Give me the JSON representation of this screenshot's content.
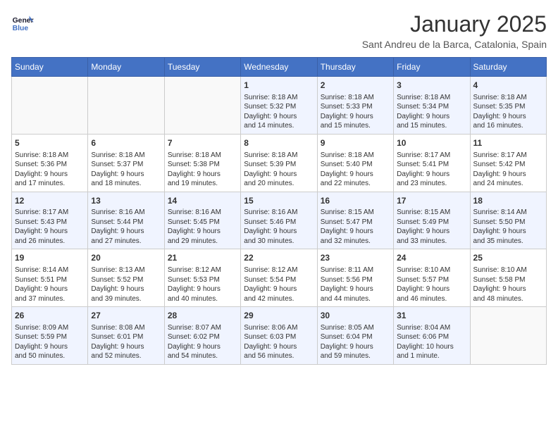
{
  "header": {
    "logo_line1": "General",
    "logo_line2": "Blue",
    "month_title": "January 2025",
    "subtitle": "Sant Andreu de la Barca, Catalonia, Spain"
  },
  "weekdays": [
    "Sunday",
    "Monday",
    "Tuesday",
    "Wednesday",
    "Thursday",
    "Friday",
    "Saturday"
  ],
  "weeks": [
    [
      {
        "day": "",
        "info": ""
      },
      {
        "day": "",
        "info": ""
      },
      {
        "day": "",
        "info": ""
      },
      {
        "day": "1",
        "info": "Sunrise: 8:18 AM\nSunset: 5:32 PM\nDaylight: 9 hours\nand 14 minutes."
      },
      {
        "day": "2",
        "info": "Sunrise: 8:18 AM\nSunset: 5:33 PM\nDaylight: 9 hours\nand 15 minutes."
      },
      {
        "day": "3",
        "info": "Sunrise: 8:18 AM\nSunset: 5:34 PM\nDaylight: 9 hours\nand 15 minutes."
      },
      {
        "day": "4",
        "info": "Sunrise: 8:18 AM\nSunset: 5:35 PM\nDaylight: 9 hours\nand 16 minutes."
      }
    ],
    [
      {
        "day": "5",
        "info": "Sunrise: 8:18 AM\nSunset: 5:36 PM\nDaylight: 9 hours\nand 17 minutes."
      },
      {
        "day": "6",
        "info": "Sunrise: 8:18 AM\nSunset: 5:37 PM\nDaylight: 9 hours\nand 18 minutes."
      },
      {
        "day": "7",
        "info": "Sunrise: 8:18 AM\nSunset: 5:38 PM\nDaylight: 9 hours\nand 19 minutes."
      },
      {
        "day": "8",
        "info": "Sunrise: 8:18 AM\nSunset: 5:39 PM\nDaylight: 9 hours\nand 20 minutes."
      },
      {
        "day": "9",
        "info": "Sunrise: 8:18 AM\nSunset: 5:40 PM\nDaylight: 9 hours\nand 22 minutes."
      },
      {
        "day": "10",
        "info": "Sunrise: 8:17 AM\nSunset: 5:41 PM\nDaylight: 9 hours\nand 23 minutes."
      },
      {
        "day": "11",
        "info": "Sunrise: 8:17 AM\nSunset: 5:42 PM\nDaylight: 9 hours\nand 24 minutes."
      }
    ],
    [
      {
        "day": "12",
        "info": "Sunrise: 8:17 AM\nSunset: 5:43 PM\nDaylight: 9 hours\nand 26 minutes."
      },
      {
        "day": "13",
        "info": "Sunrise: 8:16 AM\nSunset: 5:44 PM\nDaylight: 9 hours\nand 27 minutes."
      },
      {
        "day": "14",
        "info": "Sunrise: 8:16 AM\nSunset: 5:45 PM\nDaylight: 9 hours\nand 29 minutes."
      },
      {
        "day": "15",
        "info": "Sunrise: 8:16 AM\nSunset: 5:46 PM\nDaylight: 9 hours\nand 30 minutes."
      },
      {
        "day": "16",
        "info": "Sunrise: 8:15 AM\nSunset: 5:47 PM\nDaylight: 9 hours\nand 32 minutes."
      },
      {
        "day": "17",
        "info": "Sunrise: 8:15 AM\nSunset: 5:49 PM\nDaylight: 9 hours\nand 33 minutes."
      },
      {
        "day": "18",
        "info": "Sunrise: 8:14 AM\nSunset: 5:50 PM\nDaylight: 9 hours\nand 35 minutes."
      }
    ],
    [
      {
        "day": "19",
        "info": "Sunrise: 8:14 AM\nSunset: 5:51 PM\nDaylight: 9 hours\nand 37 minutes."
      },
      {
        "day": "20",
        "info": "Sunrise: 8:13 AM\nSunset: 5:52 PM\nDaylight: 9 hours\nand 39 minutes."
      },
      {
        "day": "21",
        "info": "Sunrise: 8:12 AM\nSunset: 5:53 PM\nDaylight: 9 hours\nand 40 minutes."
      },
      {
        "day": "22",
        "info": "Sunrise: 8:12 AM\nSunset: 5:54 PM\nDaylight: 9 hours\nand 42 minutes."
      },
      {
        "day": "23",
        "info": "Sunrise: 8:11 AM\nSunset: 5:56 PM\nDaylight: 9 hours\nand 44 minutes."
      },
      {
        "day": "24",
        "info": "Sunrise: 8:10 AM\nSunset: 5:57 PM\nDaylight: 9 hours\nand 46 minutes."
      },
      {
        "day": "25",
        "info": "Sunrise: 8:10 AM\nSunset: 5:58 PM\nDaylight: 9 hours\nand 48 minutes."
      }
    ],
    [
      {
        "day": "26",
        "info": "Sunrise: 8:09 AM\nSunset: 5:59 PM\nDaylight: 9 hours\nand 50 minutes."
      },
      {
        "day": "27",
        "info": "Sunrise: 8:08 AM\nSunset: 6:01 PM\nDaylight: 9 hours\nand 52 minutes."
      },
      {
        "day": "28",
        "info": "Sunrise: 8:07 AM\nSunset: 6:02 PM\nDaylight: 9 hours\nand 54 minutes."
      },
      {
        "day": "29",
        "info": "Sunrise: 8:06 AM\nSunset: 6:03 PM\nDaylight: 9 hours\nand 56 minutes."
      },
      {
        "day": "30",
        "info": "Sunrise: 8:05 AM\nSunset: 6:04 PM\nDaylight: 9 hours\nand 59 minutes."
      },
      {
        "day": "31",
        "info": "Sunrise: 8:04 AM\nSunset: 6:06 PM\nDaylight: 10 hours\nand 1 minute."
      },
      {
        "day": "",
        "info": ""
      }
    ]
  ]
}
